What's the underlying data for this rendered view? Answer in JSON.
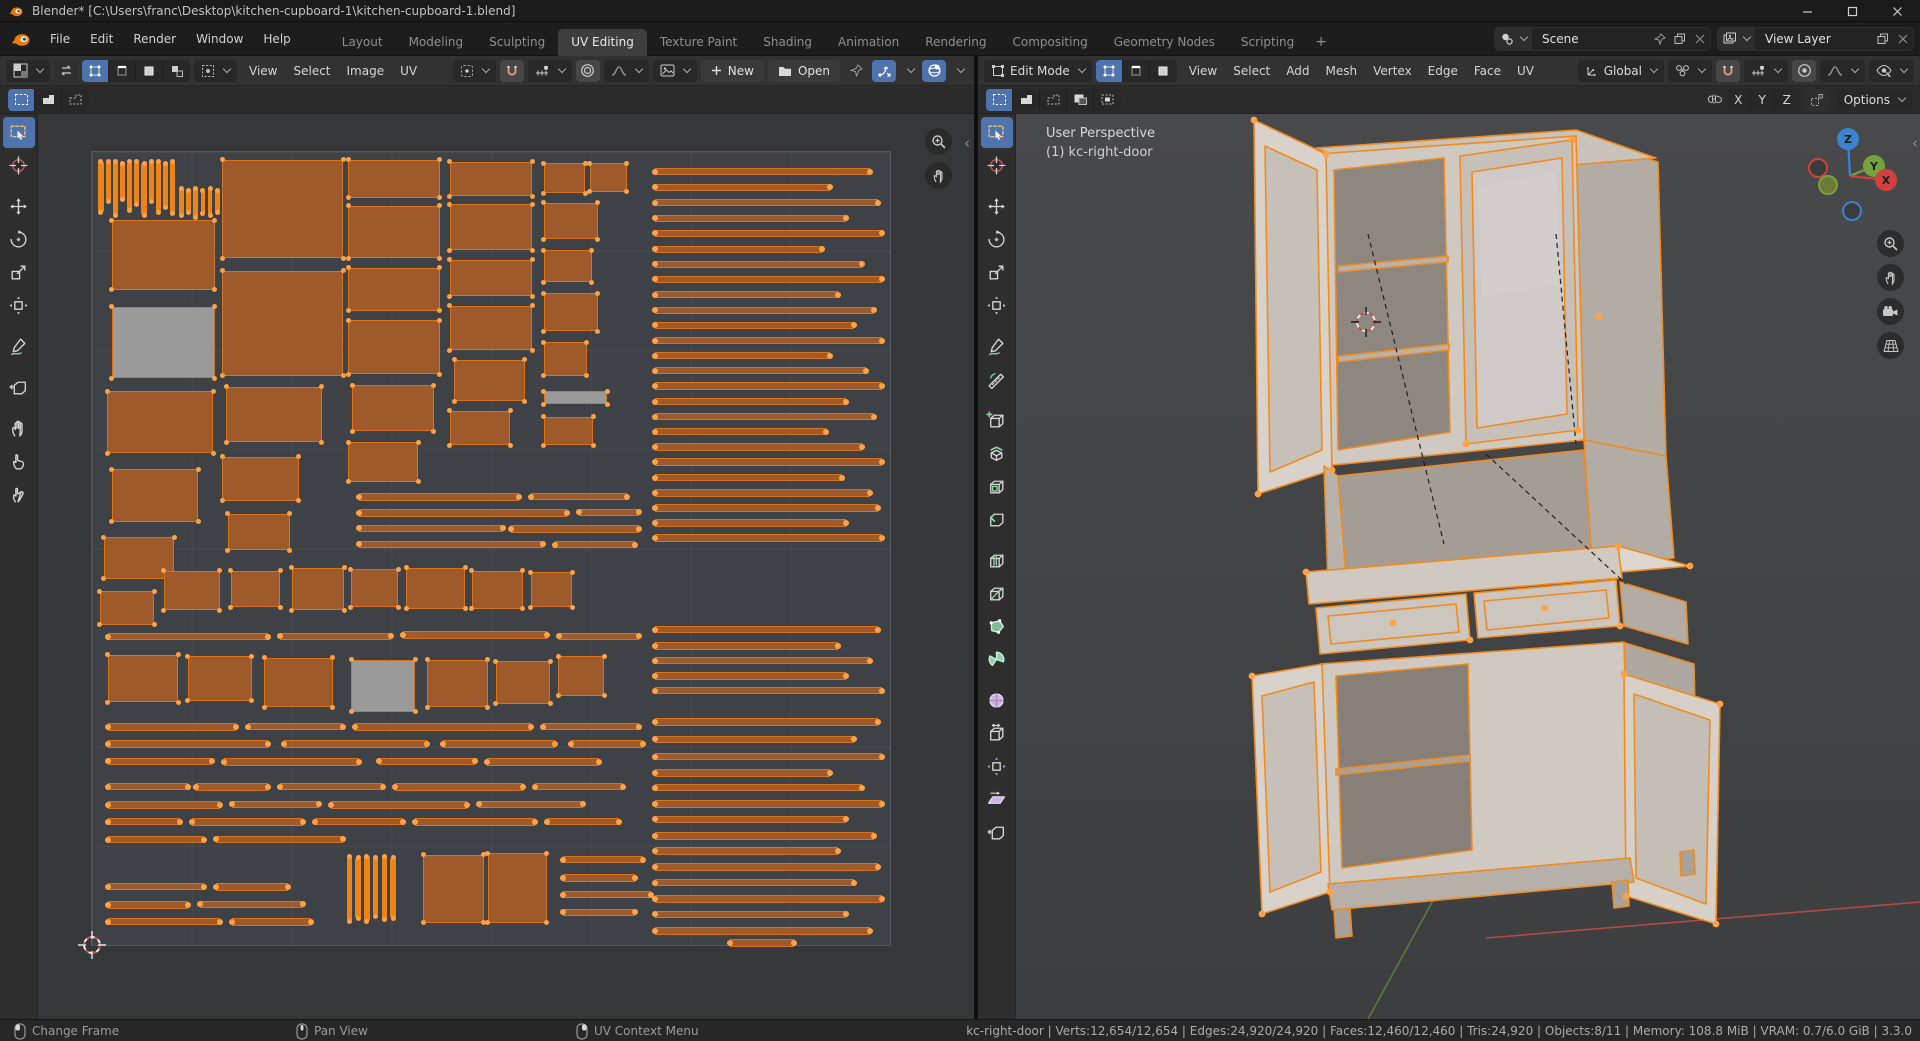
{
  "window": {
    "title": "Blender* [C:\\Users\\franc\\Desktop\\kitchen-cupboard-1\\kitchen-cupboard-1.blend]"
  },
  "topbar": {
    "menus": [
      "File",
      "Edit",
      "Render",
      "Window",
      "Help"
    ],
    "tabs": [
      "Layout",
      "Modeling",
      "Sculpting",
      "UV Editing",
      "Texture Paint",
      "Shading",
      "Animation",
      "Rendering",
      "Compositing",
      "Geometry Nodes",
      "Scripting"
    ],
    "active_tab": "UV Editing",
    "new_tab_label": "+",
    "scene_label": "Scene",
    "view_layer_label": "View Layer"
  },
  "uv_editor": {
    "menus": [
      "View",
      "Select",
      "Image",
      "UV"
    ],
    "new_label": "New",
    "open_label": "Open",
    "tools": [
      "box-select",
      "cursor",
      "move",
      "rotate",
      "scale",
      "transform",
      "annotate",
      "rip-region",
      "grab",
      "relax",
      "pinch"
    ],
    "active_tool": "box-select",
    "select_mode_count": 4,
    "tool_settings_modes": [
      "new",
      "extend",
      "subtract"
    ]
  },
  "viewport3d": {
    "mode_label": "Edit Mode",
    "menus": [
      "View",
      "Select",
      "Add",
      "Mesh",
      "Vertex",
      "Edge",
      "Face",
      "UV"
    ],
    "orientation_label": "Global",
    "options_label": "Options",
    "axis_buttons": [
      "X",
      "Y",
      "Z"
    ],
    "tools": [
      "box-select",
      "cursor",
      "move",
      "rotate",
      "scale",
      "transform",
      "annotate",
      "measure",
      "add-cube",
      "extrude",
      "inset",
      "bevel",
      "loop-cut",
      "knife",
      "poly-build",
      "spin",
      "smooth",
      "edge-slide",
      "shrink-fatten",
      "shear",
      "rip-region"
    ],
    "active_tool": "box-select",
    "tool_settings_modes": [
      "new",
      "extend",
      "subtract",
      "invert",
      "intersect"
    ],
    "overlay": {
      "perspective_label": "User Perspective",
      "object_label": "(1) kc-right-door"
    },
    "gizmo_axes": [
      "X",
      "Y",
      "Z"
    ]
  },
  "status_bar": {
    "hints": [
      {
        "button": "left",
        "label": "Change Frame"
      },
      {
        "button": "middle",
        "label": "Pan View"
      },
      {
        "button": "right",
        "label": "UV Context Menu"
      }
    ],
    "stats": "kc-right-door | Verts:12,654/12,654 | Edges:24,920/24,920 | Faces:12,460/12,460 | Tris:24,920 | Objects:8/11 | Memory: 108.8 MiB | VRAM: 0.7/6.0 GiB | 3.3.0"
  },
  "colors": {
    "accent_blue": "#4f74ad",
    "uv_island_fill": "#9e5a2b",
    "uv_island_border": "#d9731a",
    "uv_vertex_dot": "#ffa144",
    "unselected_island": "#9a9a9a",
    "mesh_edge_orange": "#ef8b1f",
    "axis_x_red": "#d23f3f",
    "axis_y_green": "#73a33c",
    "axis_z_blue": "#3b83d0"
  },
  "uv_islands": {
    "islands": [
      [
        0.8,
        1.2,
        0.65,
        6.4,
        2
      ],
      [
        1.7,
        1.2,
        0.65,
        5.0,
        2
      ],
      [
        2.6,
        1.2,
        0.65,
        6.8,
        2
      ],
      [
        3.5,
        1.4,
        0.65,
        4.6,
        2
      ],
      [
        4.4,
        1.2,
        0.65,
        6.2,
        2
      ],
      [
        5.3,
        1.2,
        0.65,
        5.4,
        2
      ],
      [
        6.2,
        1.4,
        0.65,
        6.6,
        2
      ],
      [
        7.1,
        1.2,
        0.65,
        5.0,
        2
      ],
      [
        8.0,
        1.2,
        0.65,
        6.4,
        2
      ],
      [
        8.9,
        1.4,
        0.65,
        5.6,
        2
      ],
      [
        9.8,
        1.2,
        0.65,
        6.6,
        2
      ],
      [
        10.9,
        4.6,
        0.6,
        3.4,
        2
      ],
      [
        11.8,
        4.8,
        0.6,
        2.8,
        2
      ],
      [
        12.7,
        4.6,
        0.6,
        3.6,
        2
      ],
      [
        13.6,
        4.8,
        0.6,
        3.0,
        2
      ],
      [
        14.5,
        4.6,
        0.6,
        3.4,
        2
      ],
      [
        15.4,
        4.8,
        0.6,
        2.8,
        2
      ],
      [
        31.9,
        88.8,
        0.7,
        8.2,
        2
      ],
      [
        33.0,
        89.0,
        0.7,
        7.6,
        2
      ],
      [
        34.1,
        88.8,
        0.7,
        8.2,
        2
      ],
      [
        35.2,
        89.0,
        0.7,
        7.4,
        2
      ],
      [
        36.3,
        88.8,
        0.7,
        8.0,
        2
      ],
      [
        37.4,
        89.0,
        0.7,
        7.6,
        2
      ],
      [
        2.5,
        8.6,
        12.9,
        8.8,
        0
      ],
      [
        2.5,
        19.5,
        12.9,
        9.0,
        1
      ],
      [
        1.9,
        30.2,
        13.3,
        7.8,
        0
      ],
      [
        2.5,
        40.0,
        10.8,
        6.6,
        0
      ],
      [
        1.5,
        48.6,
        8.8,
        5.2,
        0
      ],
      [
        1.0,
        55.4,
        6.8,
        4.2,
        0
      ],
      [
        16.3,
        1.0,
        15.2,
        12.4,
        0
      ],
      [
        16.3,
        15.0,
        15.2,
        13.2,
        0
      ],
      [
        16.8,
        29.6,
        12.0,
        7.0,
        0
      ],
      [
        16.3,
        38.4,
        9.6,
        5.6,
        0
      ],
      [
        17.0,
        45.6,
        7.8,
        4.6,
        0
      ],
      [
        32.1,
        1.0,
        11.5,
        4.8,
        0
      ],
      [
        32.1,
        6.8,
        11.5,
        6.6,
        0
      ],
      [
        32.1,
        14.6,
        11.5,
        5.4,
        0
      ],
      [
        32.1,
        21.2,
        11.5,
        6.8,
        0
      ],
      [
        32.6,
        29.4,
        10.2,
        5.8,
        0
      ],
      [
        32.1,
        36.6,
        8.8,
        5.0,
        0
      ],
      [
        44.8,
        1.2,
        10.4,
        4.4,
        0
      ],
      [
        44.8,
        6.6,
        10.4,
        5.8,
        0
      ],
      [
        44.8,
        13.6,
        10.4,
        4.6,
        0
      ],
      [
        44.8,
        19.4,
        10.4,
        5.6,
        0
      ],
      [
        45.4,
        26.2,
        8.8,
        5.2,
        0
      ],
      [
        44.8,
        32.6,
        7.6,
        4.4,
        0
      ],
      [
        56.6,
        1.4,
        5.2,
        3.8,
        0
      ],
      [
        62.4,
        1.4,
        4.6,
        3.6,
        0
      ],
      [
        56.6,
        6.4,
        6.8,
        4.6,
        0
      ],
      [
        56.6,
        12.4,
        6.0,
        4.0,
        0
      ],
      [
        56.6,
        17.8,
        6.8,
        4.8,
        0
      ],
      [
        56.6,
        24.0,
        5.4,
        4.2,
        0
      ],
      [
        56.6,
        30.2,
        8.0,
        1.6,
        1
      ],
      [
        56.6,
        33.4,
        6.2,
        3.6,
        0
      ],
      [
        9.0,
        52.8,
        7.0,
        5.0,
        0
      ],
      [
        17.4,
        52.8,
        6.2,
        4.6,
        0
      ],
      [
        25.0,
        52.4,
        6.6,
        5.4,
        0
      ],
      [
        32.4,
        52.6,
        6.0,
        4.8,
        0
      ],
      [
        39.4,
        52.4,
        7.4,
        5.2,
        0
      ],
      [
        47.6,
        52.8,
        6.4,
        4.8,
        0
      ],
      [
        55.0,
        53.0,
        5.2,
        4.4,
        0
      ],
      [
        2.0,
        63.4,
        8.8,
        6.0,
        0
      ],
      [
        12.0,
        63.6,
        8.0,
        5.6,
        0
      ],
      [
        21.6,
        63.8,
        8.6,
        6.2,
        0
      ],
      [
        32.5,
        64.0,
        8.0,
        6.6,
        1
      ],
      [
        42.0,
        64.0,
        7.6,
        6.0,
        0
      ],
      [
        50.6,
        64.2,
        6.8,
        5.4,
        0
      ],
      [
        58.4,
        63.6,
        5.8,
        5.0,
        0
      ],
      [
        41.5,
        88.6,
        7.6,
        8.6,
        0
      ],
      [
        49.6,
        88.4,
        7.4,
        8.8,
        0
      ],
      [
        70.5,
        2.0,
        27,
        0.95,
        3
      ],
      [
        70.5,
        4.0,
        22,
        0.95,
        3
      ],
      [
        70.5,
        5.9,
        28,
        0.95,
        3
      ],
      [
        70.5,
        7.9,
        24,
        0.95,
        3
      ],
      [
        70.5,
        9.8,
        28.5,
        0.95,
        3
      ],
      [
        70.5,
        11.8,
        21,
        0.95,
        3
      ],
      [
        70.5,
        13.7,
        26,
        0.95,
        3
      ],
      [
        70.5,
        15.6,
        28.5,
        0.95,
        3
      ],
      [
        70.5,
        17.5,
        23,
        0.95,
        3
      ],
      [
        70.5,
        19.5,
        27.5,
        0.95,
        3
      ],
      [
        70.5,
        21.4,
        25,
        0.95,
        3
      ],
      [
        70.5,
        23.3,
        28.5,
        0.95,
        3
      ],
      [
        70.5,
        25.2,
        22,
        0.95,
        3
      ],
      [
        70.5,
        27.1,
        26.5,
        0.95,
        3
      ],
      [
        70.5,
        29.0,
        28.5,
        0.95,
        3
      ],
      [
        70.5,
        31.0,
        24,
        0.95,
        3
      ],
      [
        70.5,
        32.9,
        27.5,
        0.95,
        3
      ],
      [
        70.5,
        34.8,
        21.5,
        0.95,
        3
      ],
      [
        70.5,
        36.7,
        26,
        0.95,
        3
      ],
      [
        70.5,
        38.6,
        28.5,
        0.95,
        3
      ],
      [
        70.5,
        40.6,
        23.5,
        0.95,
        3
      ],
      [
        70.5,
        42.5,
        27,
        0.95,
        3
      ],
      [
        70.5,
        44.4,
        28,
        0.95,
        3
      ],
      [
        70.5,
        46.3,
        24,
        0.95,
        3
      ],
      [
        70.5,
        48.2,
        28.5,
        0.95,
        3
      ],
      [
        33.5,
        43.0,
        20,
        1.0,
        3
      ],
      [
        55.0,
        43.0,
        12,
        0.9,
        3
      ],
      [
        33.5,
        45.0,
        26,
        1.0,
        3
      ],
      [
        61.0,
        45.0,
        7.5,
        0.9,
        3
      ],
      [
        33.5,
        47.0,
        18,
        0.9,
        3
      ],
      [
        52.5,
        47.0,
        16,
        1.0,
        3
      ],
      [
        33.5,
        49.0,
        23,
        0.9,
        3
      ],
      [
        58.0,
        49.0,
        10,
        1.0,
        3
      ],
      [
        2.0,
        60.6,
        20,
        1.0,
        3
      ],
      [
        23.5,
        60.6,
        14,
        0.9,
        3
      ],
      [
        39.0,
        60.4,
        18,
        1.0,
        3
      ],
      [
        58.5,
        60.6,
        10,
        0.9,
        3
      ],
      [
        70.5,
        59.8,
        28,
        0.9,
        3
      ],
      [
        70.5,
        61.8,
        23,
        1.0,
        3
      ],
      [
        70.5,
        63.7,
        27,
        0.9,
        3
      ],
      [
        70.5,
        65.6,
        24,
        1.0,
        3
      ],
      [
        70.5,
        67.5,
        28.5,
        0.9,
        3
      ],
      [
        2.0,
        72.0,
        16,
        1.0,
        3
      ],
      [
        19.5,
        72.0,
        12,
        0.9,
        3
      ],
      [
        33.0,
        72.0,
        22,
        1.0,
        3
      ],
      [
        56.5,
        72.0,
        12,
        0.9,
        3
      ],
      [
        70.5,
        71.4,
        28,
        1.0,
        3
      ],
      [
        2.0,
        74.2,
        20,
        0.9,
        3
      ],
      [
        24.0,
        74.2,
        18,
        1.0,
        3
      ],
      [
        44.0,
        74.2,
        14,
        0.9,
        3
      ],
      [
        60.0,
        74.2,
        9,
        1.0,
        3
      ],
      [
        70.5,
        73.6,
        25,
        0.9,
        3
      ],
      [
        2.0,
        76.4,
        13,
        0.9,
        3
      ],
      [
        16.5,
        76.4,
        17,
        1.0,
        3
      ],
      [
        36.0,
        76.4,
        12,
        0.9,
        3
      ],
      [
        49.5,
        76.4,
        14,
        1.0,
        3
      ],
      [
        70.5,
        75.8,
        28.5,
        0.9,
        3
      ],
      [
        70.5,
        77.8,
        22,
        1.0,
        3
      ],
      [
        2.0,
        79.6,
        10,
        0.9,
        3
      ],
      [
        13.0,
        79.6,
        9,
        1.0,
        3
      ],
      [
        23.5,
        79.6,
        13,
        0.9,
        3
      ],
      [
        38.0,
        79.6,
        16,
        1.0,
        3
      ],
      [
        55.5,
        79.6,
        11,
        0.9,
        3
      ],
      [
        70.5,
        79.7,
        26,
        0.9,
        3
      ],
      [
        2.0,
        81.8,
        14,
        1.0,
        3
      ],
      [
        17.5,
        81.8,
        11,
        0.9,
        3
      ],
      [
        30.0,
        81.8,
        17,
        1.0,
        3
      ],
      [
        48.5,
        81.8,
        13,
        0.9,
        3
      ],
      [
        70.5,
        81.7,
        28.5,
        1.0,
        3
      ],
      [
        2.0,
        84.0,
        9,
        0.9,
        3
      ],
      [
        12.5,
        84.0,
        14,
        1.0,
        3
      ],
      [
        28.0,
        84.0,
        11,
        0.9,
        3
      ],
      [
        40.5,
        84.0,
        15,
        1.0,
        3
      ],
      [
        57.0,
        84.0,
        9,
        0.9,
        3
      ],
      [
        70.5,
        83.7,
        24,
        0.9,
        3
      ],
      [
        2.0,
        86.2,
        12,
        1.0,
        3
      ],
      [
        15.5,
        86.2,
        16,
        0.9,
        3
      ],
      [
        70.5,
        85.7,
        27.5,
        1.0,
        3
      ],
      [
        70.5,
        87.7,
        23,
        0.9,
        3
      ],
      [
        59.0,
        88.8,
        10,
        0.9,
        3
      ],
      [
        70.5,
        89.7,
        28,
        1.0,
        3
      ],
      [
        59.0,
        91.0,
        9,
        1.0,
        3
      ],
      [
        70.5,
        91.7,
        25,
        0.9,
        3
      ],
      [
        2.0,
        92.2,
        12,
        0.9,
        3
      ],
      [
        15.5,
        92.2,
        9,
        1.0,
        3
      ],
      [
        2.0,
        94.4,
        10,
        1.0,
        3
      ],
      [
        13.5,
        94.4,
        13,
        0.9,
        3
      ],
      [
        59.0,
        93.2,
        11,
        0.9,
        3
      ],
      [
        70.5,
        93.7,
        28.5,
        1.0,
        3
      ],
      [
        2.0,
        96.6,
        14,
        0.9,
        3
      ],
      [
        17.5,
        96.6,
        10,
        1.0,
        3
      ],
      [
        59.0,
        95.4,
        9,
        0.9,
        3
      ],
      [
        70.5,
        95.7,
        24,
        0.9,
        3
      ],
      [
        70.5,
        97.7,
        27,
        1.0,
        3
      ],
      [
        80.0,
        99.3,
        8.0,
        1.0,
        3
      ]
    ]
  }
}
